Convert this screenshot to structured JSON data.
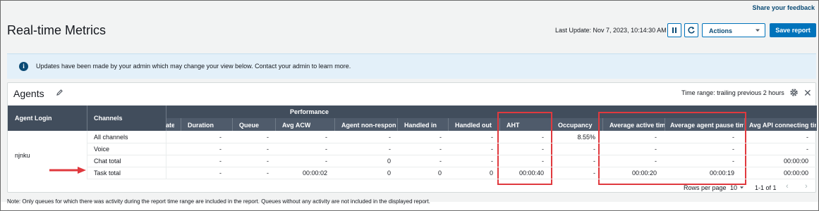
{
  "feedback_link": "Share your feedback",
  "page_title": "Real-time Metrics",
  "last_update": "Last Update: Nov 7, 2023, 10:14:30 AM",
  "actions_label": "Actions",
  "save_label": "Save report",
  "banner_message": "Updates have been made by your admin which may change your view below. Contact your admin to learn more.",
  "card": {
    "title": "Agents",
    "time_range": "Time range: trailing previous 2 hours"
  },
  "table": {
    "fixed_headers": [
      "Agent Login",
      "Channels"
    ],
    "group_header": "Performance",
    "columns": [
      "ate",
      "Duration",
      "Queue",
      "Avg ACW",
      "Agent non-response",
      "Handled in",
      "Handled out",
      "AHT",
      "Occupancy",
      "Average active time",
      "Average agent pause time",
      "Avg API connecting time"
    ],
    "agent": "njnku",
    "rows": [
      {
        "channel": "All channels",
        "values": [
          "",
          "-",
          "-",
          "-",
          "-",
          "-",
          "-",
          "-",
          "8.55%",
          "-",
          "-",
          "-"
        ]
      },
      {
        "channel": "Voice",
        "values": [
          "",
          "-",
          "-",
          "-",
          "-",
          "-",
          "-",
          "-",
          "-",
          "-",
          "-",
          "-"
        ]
      },
      {
        "channel": "Chat total",
        "values": [
          "",
          "-",
          "-",
          "-",
          "0",
          "-",
          "-",
          "-",
          "-",
          "-",
          "-",
          "00:00:00"
        ]
      },
      {
        "channel": "Task total",
        "values": [
          "",
          "-",
          "-",
          "00:00:02",
          "0",
          "0",
          "0",
          "00:00:40",
          "-",
          "00:00:20",
          "00:00:19",
          "00:00:00"
        ]
      }
    ]
  },
  "pagination": {
    "rows_per_page_label": "Rows per page",
    "rows_per_page": "10",
    "range": "1-1 of 1"
  },
  "footer_note": "Note: Only queues for which there was activity during the report time range are included in the report. Queues without any activity are not included in the displayed report.",
  "colors": {
    "primary": "#0073bb",
    "header_dark": "#414d5c",
    "highlight": "#e0393e",
    "banner_bg": "#e3f0f9"
  },
  "icons": [
    "pause-icon",
    "refresh-icon",
    "info-icon",
    "pencil-icon",
    "gear-icon",
    "close-icon",
    "arrow-icon"
  ]
}
